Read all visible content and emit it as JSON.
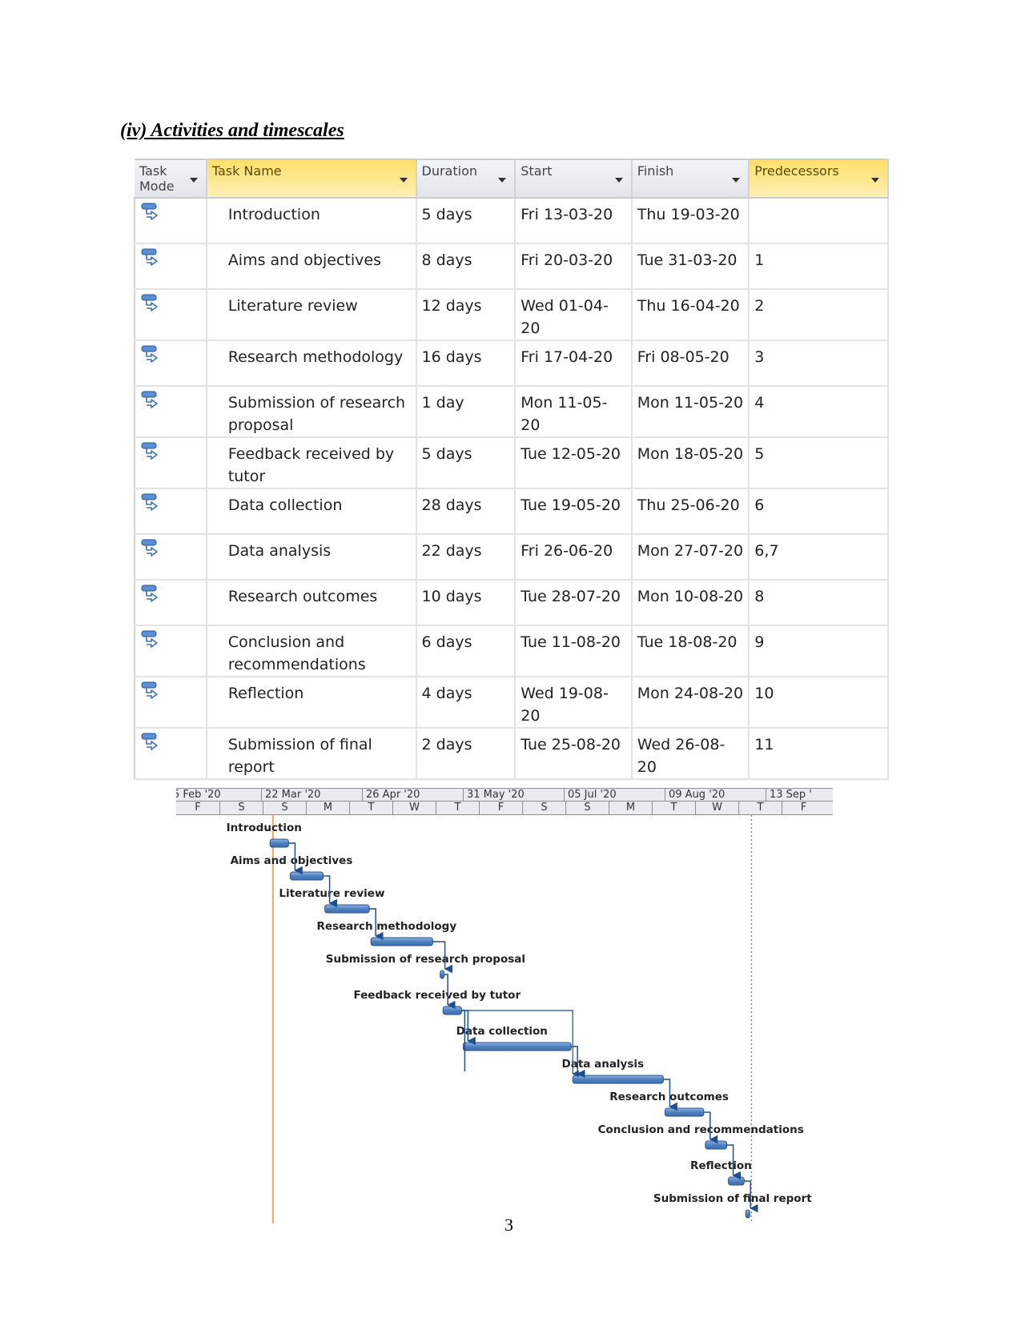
{
  "heading": "(iv) Activities and timescales",
  "table": {
    "columns": [
      {
        "key": "mode",
        "label": "Task Mode"
      },
      {
        "key": "name",
        "label": "Task Name"
      },
      {
        "key": "duration",
        "label": "Duration"
      },
      {
        "key": "start",
        "label": "Start"
      },
      {
        "key": "finish",
        "label": "Finish"
      },
      {
        "key": "predecessors",
        "label": "Predecessors"
      }
    ],
    "mode_icon": "auto-scheduled-task-icon",
    "rows": [
      {
        "name": "Introduction",
        "duration": "5 days",
        "start": "Fri 13-03-20",
        "finish": "Thu 19-03-20",
        "predecessors": ""
      },
      {
        "name": "Aims and objectives",
        "duration": "8 days",
        "start": "Fri 20-03-20",
        "finish": "Tue 31-03-20",
        "predecessors": "1"
      },
      {
        "name": "Literature review",
        "duration": "12 days",
        "start": "Wed 01-04-20",
        "finish": "Thu 16-04-20",
        "predecessors": "2"
      },
      {
        "name": "Research methodology",
        "duration": "16 days",
        "start": "Fri 17-04-20",
        "finish": "Fri 08-05-20",
        "predecessors": "3"
      },
      {
        "name": "Submission of research proposal",
        "duration": "1 day",
        "start": "Mon 11-05-20",
        "finish": "Mon 11-05-20",
        "predecessors": "4"
      },
      {
        "name": "Feedback received by tutor",
        "duration": "5 days",
        "start": "Tue 12-05-20",
        "finish": "Mon 18-05-20",
        "predecessors": "5"
      },
      {
        "name": "Data collection",
        "duration": "28 days",
        "start": "Tue 19-05-20",
        "finish": "Thu 25-06-20",
        "predecessors": "6"
      },
      {
        "name": "Data analysis",
        "duration": "22 days",
        "start": "Fri 26-06-20",
        "finish": "Mon 27-07-20",
        "predecessors": "6,7"
      },
      {
        "name": "Research outcomes",
        "duration": "10 days",
        "start": "Tue 28-07-20",
        "finish": "Mon 10-08-20",
        "predecessors": "8"
      },
      {
        "name": "Conclusion and recommendations",
        "duration": "6 days",
        "start": "Tue 11-08-20",
        "finish": "Tue 18-08-20",
        "predecessors": "9"
      },
      {
        "name": "Reflection",
        "duration": "4 days",
        "start": "Wed 19-08-20",
        "finish": "Mon 24-08-20",
        "predecessors": "10"
      },
      {
        "name": "Submission of final report",
        "duration": "2 days",
        "start": "Tue 25-08-20",
        "finish": "Wed 26-08-20",
        "predecessors": "11"
      }
    ]
  },
  "gantt": {
    "timescale_top": [
      "5 Feb '20",
      "22 Mar '20",
      "26 Apr '20",
      "31 May '20",
      "05 Jul '20",
      "09 Aug '20",
      "13 Sep '"
    ],
    "timescale_bottom": [
      "F",
      "S",
      "S",
      "M",
      "T",
      "W",
      "T",
      "F",
      "S",
      "S",
      "M",
      "T",
      "W",
      "T",
      "F"
    ],
    "colors": {
      "bar": "#4f81bd",
      "bar_dark": "#2a5594",
      "link": "#1f4e8c",
      "today_line": "#f4a460",
      "status_line": "#888888"
    },
    "axis_start": "2020-02-15",
    "days_per_top_tier": 35,
    "today": "2020-03-14",
    "status_date": "2020-08-26",
    "tasks": [
      {
        "id": 1,
        "label": "Introduction",
        "start": "2020-03-13",
        "finish": "2020-03-19",
        "preds": []
      },
      {
        "id": 2,
        "label": "Aims and objectives",
        "start": "2020-03-20",
        "finish": "2020-03-31",
        "preds": [
          1
        ]
      },
      {
        "id": 3,
        "label": "Literature review",
        "start": "2020-04-01",
        "finish": "2020-04-16",
        "preds": [
          2
        ]
      },
      {
        "id": 4,
        "label": "Research methodology",
        "start": "2020-04-17",
        "finish": "2020-05-08",
        "preds": [
          3
        ]
      },
      {
        "id": 5,
        "label": "Submission of research proposal",
        "start": "2020-05-11",
        "finish": "2020-05-11",
        "preds": [
          4
        ]
      },
      {
        "id": 6,
        "label": "Feedback received by tutor",
        "start": "2020-05-12",
        "finish": "2020-05-18",
        "preds": [
          5
        ]
      },
      {
        "id": 7,
        "label": "Data collection",
        "start": "2020-05-19",
        "finish": "2020-06-25",
        "preds": [
          6
        ]
      },
      {
        "id": 8,
        "label": "Data analysis",
        "start": "2020-06-26",
        "finish": "2020-07-27",
        "preds": [
          6,
          7
        ]
      },
      {
        "id": 9,
        "label": "Research outcomes",
        "start": "2020-07-28",
        "finish": "2020-08-10",
        "preds": [
          8
        ]
      },
      {
        "id": 10,
        "label": "Conclusion and recommendations",
        "start": "2020-08-11",
        "finish": "2020-08-18",
        "preds": [
          9
        ]
      },
      {
        "id": 11,
        "label": "Reflection",
        "start": "2020-08-19",
        "finish": "2020-08-24",
        "preds": [
          10
        ]
      },
      {
        "id": 12,
        "label": "Submission of final report",
        "start": "2020-08-25",
        "finish": "2020-08-26",
        "preds": [
          11
        ]
      }
    ]
  },
  "page_number": "3"
}
